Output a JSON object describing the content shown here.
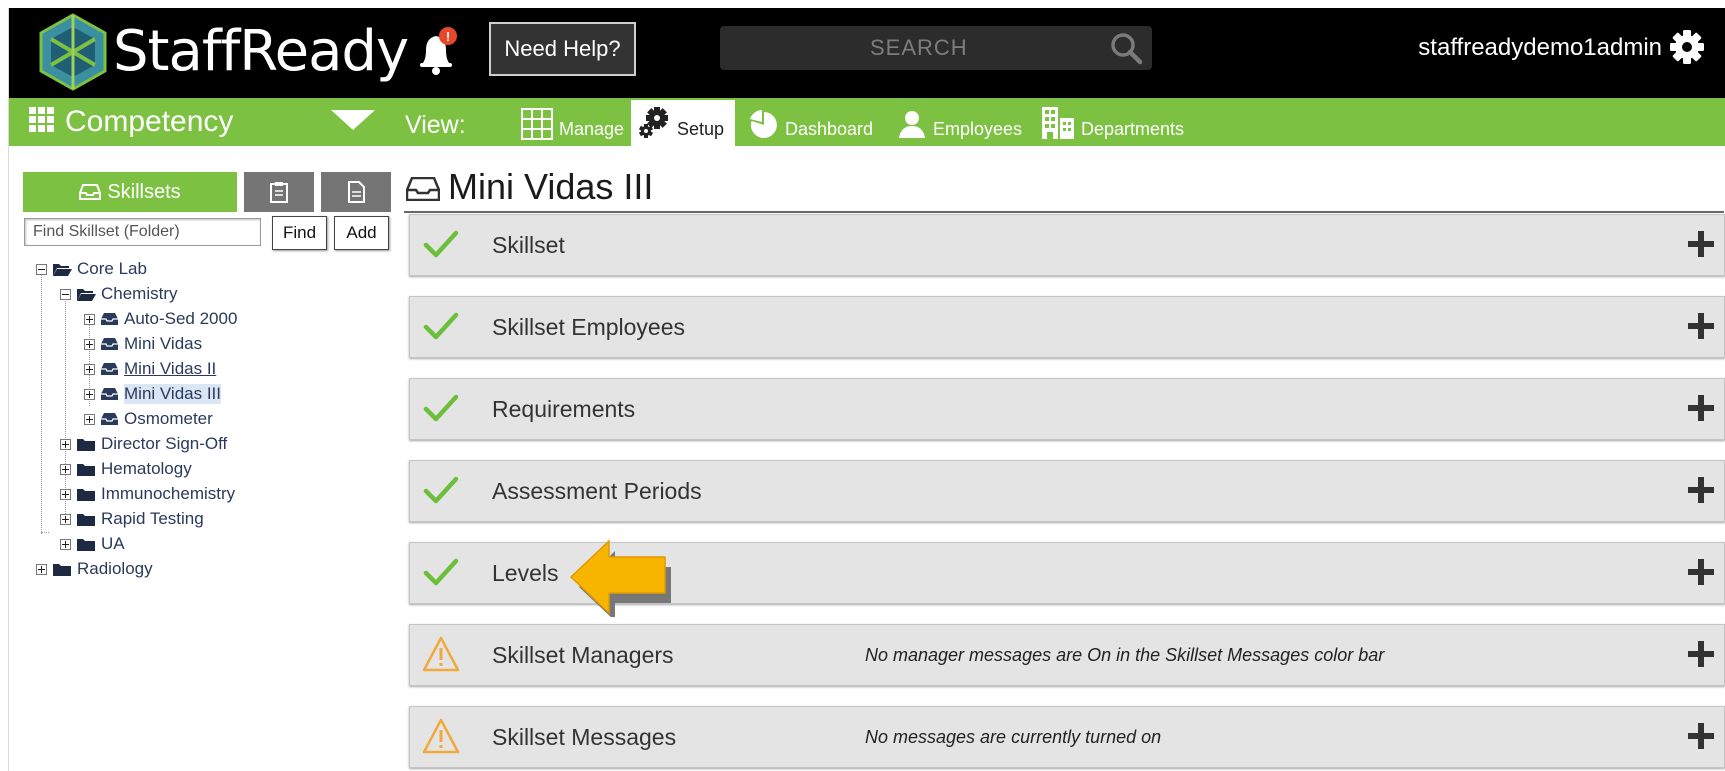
{
  "header": {
    "logo_text": "StaffReady",
    "notification_badge": "!",
    "help_label": "Need Help?",
    "search_placeholder": "SEARCH",
    "username": "staffreadydemo1admin"
  },
  "navbar": {
    "app_title": "Competency",
    "view_label": "View:",
    "tabs": [
      {
        "label": "Manage",
        "icon": "grid-icon",
        "active": false
      },
      {
        "label": "Setup",
        "icon": "gears-icon",
        "active": true
      },
      {
        "label": "Dashboard",
        "icon": "pie-chart-icon",
        "active": false
      },
      {
        "label": "Employees",
        "icon": "person-icon",
        "active": false
      },
      {
        "label": "Departments",
        "icon": "building-icon",
        "active": false
      }
    ]
  },
  "sidebar": {
    "skillsets_tab": "Skillsets",
    "find_placeholder": "Find Skillset (Folder)",
    "find_label": "Find",
    "add_label": "Add",
    "tree": [
      {
        "label": "Core Lab",
        "level": 0,
        "expanded": true,
        "type": "folder-open"
      },
      {
        "label": "Chemistry",
        "level": 1,
        "expanded": true,
        "type": "folder-open"
      },
      {
        "label": "Auto-Sed 2000",
        "level": 2,
        "expanded": false,
        "type": "skillset"
      },
      {
        "label": "Mini Vidas",
        "level": 2,
        "expanded": false,
        "type": "skillset"
      },
      {
        "label": "Mini Vidas II",
        "level": 2,
        "expanded": false,
        "type": "skillset",
        "underline": true
      },
      {
        "label": "Mini Vidas III",
        "level": 2,
        "expanded": false,
        "type": "skillset",
        "selected": true
      },
      {
        "label": "Osmometer",
        "level": 2,
        "expanded": false,
        "type": "skillset"
      },
      {
        "label": "Director Sign-Off",
        "level": 1,
        "expanded": false,
        "type": "folder"
      },
      {
        "label": "Hematology",
        "level": 1,
        "expanded": false,
        "type": "folder"
      },
      {
        "label": "Immunochemistry",
        "level": 1,
        "expanded": false,
        "type": "folder"
      },
      {
        "label": "Rapid Testing",
        "level": 1,
        "expanded": false,
        "type": "folder"
      },
      {
        "label": "UA",
        "level": 1,
        "expanded": false,
        "type": "folder"
      },
      {
        "label": "Radiology",
        "level": 0,
        "expanded": false,
        "type": "folder"
      }
    ]
  },
  "main": {
    "title": "Mini Vidas III",
    "sections": [
      {
        "title": "Skillset",
        "status": "complete",
        "note": ""
      },
      {
        "title": "Skillset Employees",
        "status": "complete",
        "note": ""
      },
      {
        "title": "Requirements",
        "status": "complete",
        "note": ""
      },
      {
        "title": "Assessment Periods",
        "status": "complete",
        "note": ""
      },
      {
        "title": "Levels",
        "status": "complete",
        "note": ""
      },
      {
        "title": "Skillset Managers",
        "status": "warning",
        "note": "No manager messages are On in the Skillset Messages color bar"
      },
      {
        "title": "Skillset Messages",
        "status": "warning",
        "note": "No messages are currently turned on"
      }
    ]
  },
  "colors": {
    "brand_green": "#7dc142",
    "topbar": "#000000",
    "check_green": "#6cbf3a",
    "warning_orange": "#f2a93b",
    "arrow_yellow": "#f7b500",
    "tree_text": "#2a3a5c"
  }
}
